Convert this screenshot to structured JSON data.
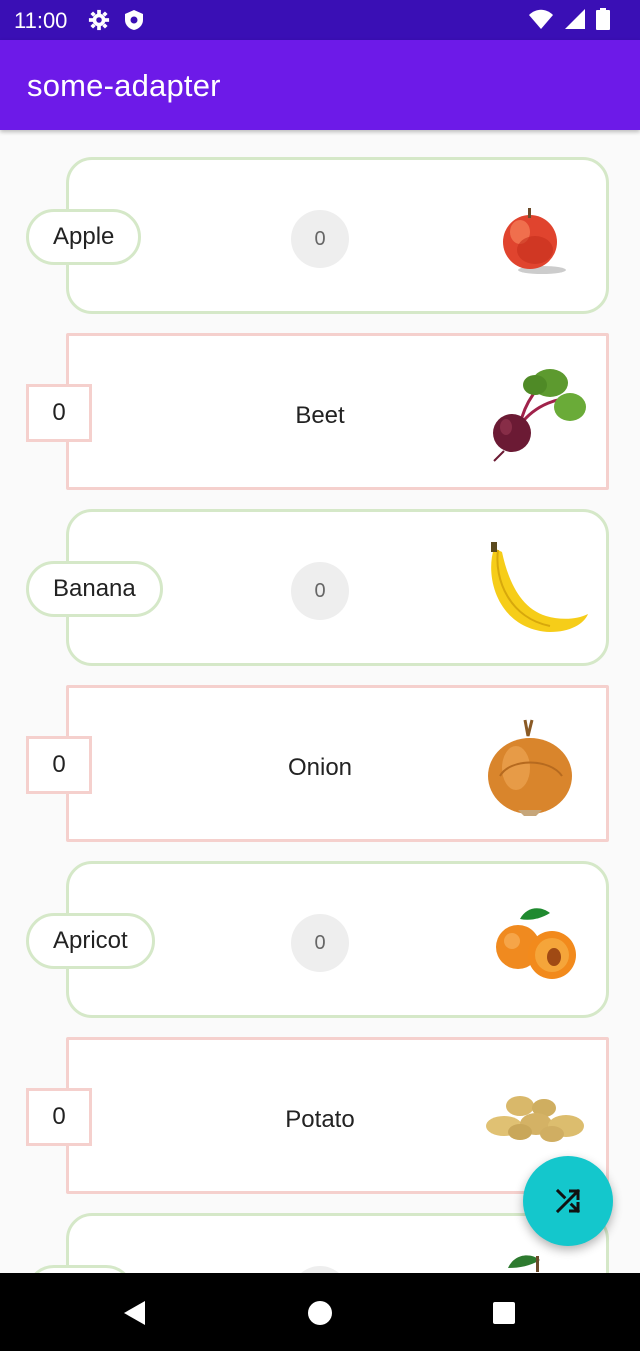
{
  "status_bar": {
    "time": "11:00"
  },
  "app_bar": {
    "title": "some-adapter"
  },
  "items": [
    {
      "kind": "fruit",
      "name": "Apple",
      "count": "0",
      "image": "apple"
    },
    {
      "kind": "veg",
      "name": "Beet",
      "count": "0",
      "image": "beet"
    },
    {
      "kind": "fruit",
      "name": "Banana",
      "count": "0",
      "image": "banana"
    },
    {
      "kind": "veg",
      "name": "Onion",
      "count": "0",
      "image": "onion"
    },
    {
      "kind": "fruit",
      "name": "Apricot",
      "count": "0",
      "image": "apricot"
    },
    {
      "kind": "veg",
      "name": "Potato",
      "count": "0",
      "image": "potato"
    }
  ],
  "fab": {
    "icon": "shuffle-icon"
  },
  "colors": {
    "status_bar": "#3a0fb5",
    "app_bar": "#6d1ae8",
    "fab": "#14c7cc",
    "fruit_border": "#d5e8c8",
    "veg_border": "#f5d0cd"
  }
}
